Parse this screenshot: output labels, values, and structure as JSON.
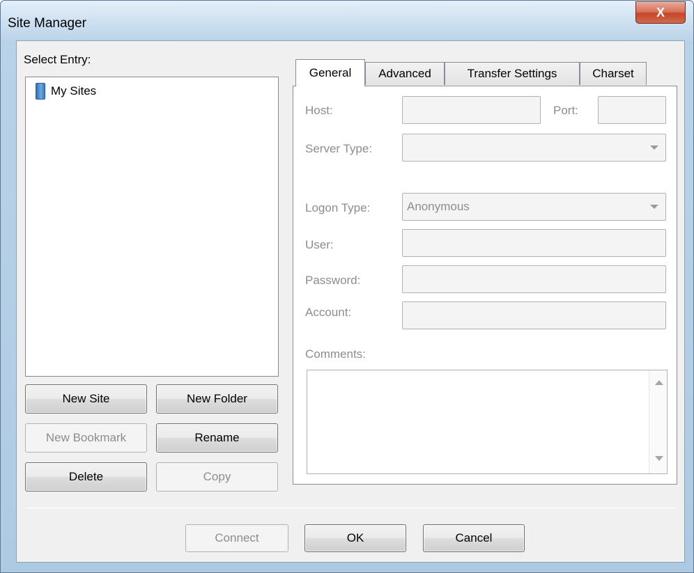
{
  "window": {
    "title": "Site Manager",
    "close_label": "X"
  },
  "left": {
    "select_entry_label": "Select Entry:",
    "tree_root": "My Sites",
    "buttons": {
      "new_site": "New Site",
      "new_folder": "New Folder",
      "new_bookmark": "New Bookmark",
      "rename": "Rename",
      "delete": "Delete",
      "copy": "Copy"
    }
  },
  "tabs": [
    "General",
    "Advanced",
    "Transfer Settings",
    "Charset"
  ],
  "general": {
    "host_label": "Host:",
    "host_value": "",
    "port_label": "Port:",
    "port_value": "",
    "server_type_label": "Server Type:",
    "server_type_value": "",
    "logon_type_label": "Logon Type:",
    "logon_type_value": "Anonymous",
    "user_label": "User:",
    "user_value": "",
    "password_label": "Password:",
    "password_value": "",
    "account_label": "Account:",
    "account_value": "",
    "comments_label": "Comments:",
    "comments_value": ""
  },
  "footer": {
    "connect": "Connect",
    "ok": "OK",
    "cancel": "Cancel"
  }
}
